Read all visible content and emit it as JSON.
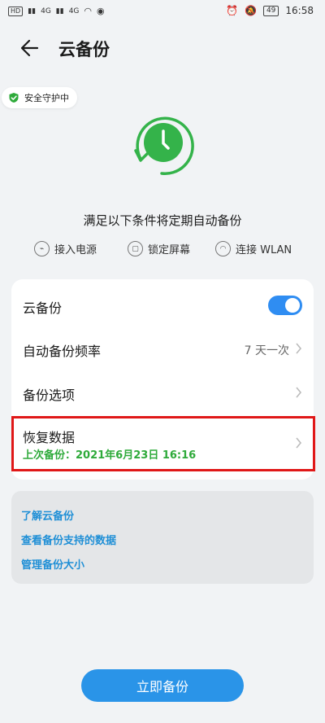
{
  "status_bar": {
    "left_badges": [
      "HD",
      "4G",
      "4G"
    ],
    "battery": "49",
    "time": "16:58"
  },
  "header": {
    "title": "云备份"
  },
  "guard_chip": {
    "label": "安全守护中"
  },
  "conditions": {
    "title": "满足以下条件将定期自动备份",
    "items": [
      {
        "label": "接入电源",
        "icon": "plug-icon"
      },
      {
        "label": "锁定屏幕",
        "icon": "lock-icon"
      },
      {
        "label": "连接 WLAN",
        "icon": "wifi-icon"
      }
    ]
  },
  "settings": {
    "cloud_backup": {
      "label": "云备份",
      "enabled": true
    },
    "frequency": {
      "label": "自动备份频率",
      "value": "7 天一次"
    },
    "options": {
      "label": "备份选项"
    },
    "restore": {
      "label": "恢复数据",
      "last_backup": "上次备份：2021年6月23日 16:16"
    }
  },
  "links": {
    "learn": "了解云备份",
    "supported_data": "查看备份支持的数据",
    "manage_size": "管理备份大小"
  },
  "actions": {
    "backup_now": "立即备份"
  },
  "colors": {
    "accent": "#2a94e8",
    "green": "#2eaa3a",
    "link": "#1f8fd6",
    "highlight": "#e01818"
  }
}
